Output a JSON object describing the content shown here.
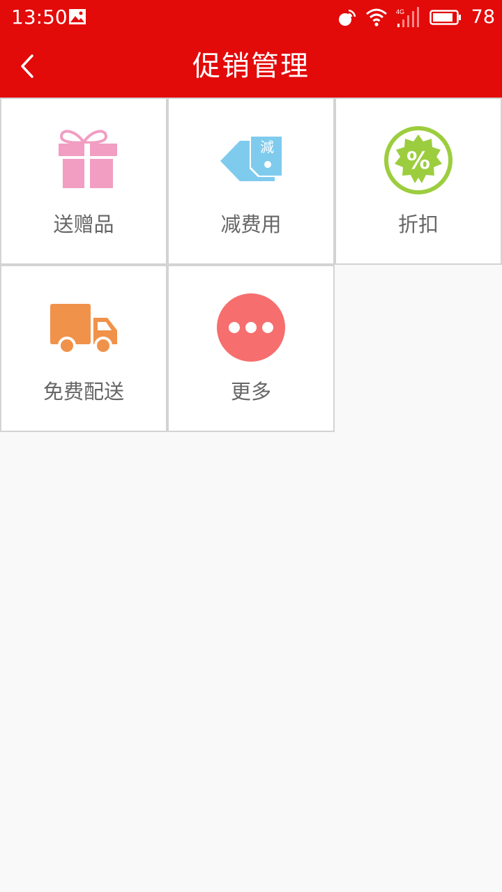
{
  "status_bar": {
    "time": "13:50",
    "battery": "78",
    "icons": [
      "gallery-icon",
      "hotspot-icon",
      "wifi-icon",
      "signal-4g-icon",
      "battery-icon"
    ]
  },
  "app_bar": {
    "title": "促销管理",
    "back_icon": "chevron-left-icon"
  },
  "menu": [
    {
      "label": "送赠品",
      "icon": "gift-icon",
      "color": "#f19ec2"
    },
    {
      "label": "减费用",
      "icon": "discount-tag-icon",
      "icon_text": "減",
      "color": "#7fcbee"
    },
    {
      "label": "折扣",
      "icon": "percent-badge-icon",
      "icon_text": "%",
      "color": "#9ccd3e"
    },
    {
      "label": "免费配送",
      "icon": "delivery-truck-icon",
      "color": "#f0924a"
    },
    {
      "label": "更多",
      "icon": "more-icon",
      "color": "#f66e6e"
    }
  ]
}
